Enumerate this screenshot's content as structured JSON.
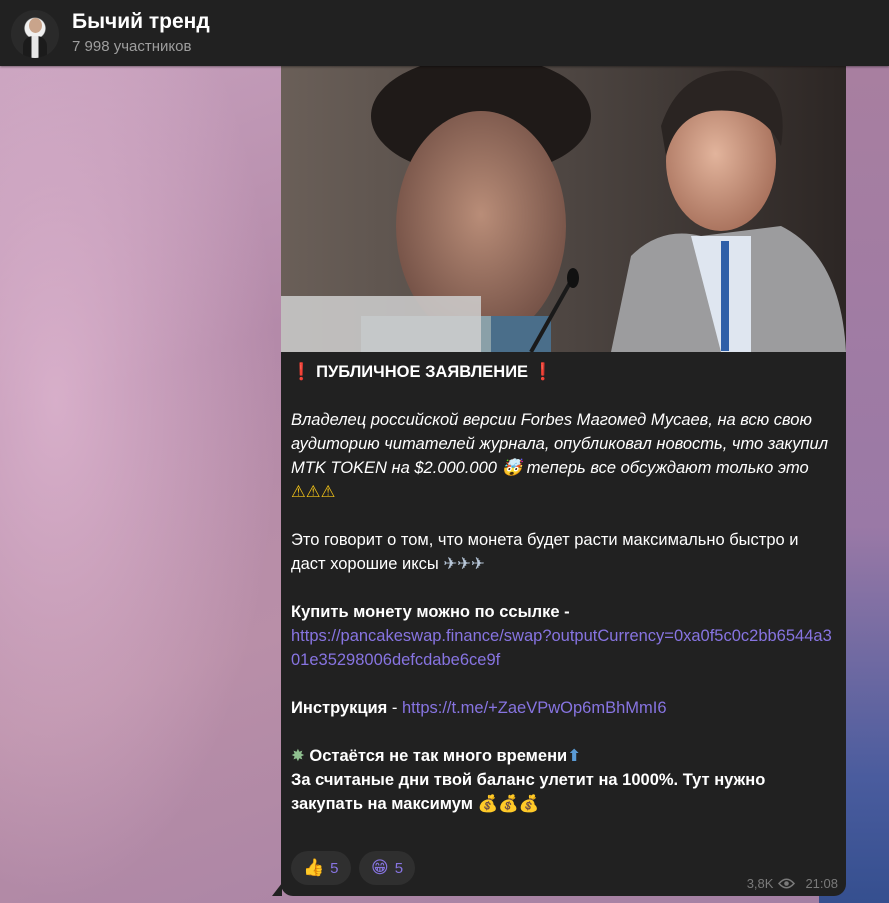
{
  "header": {
    "title": "Бычий тренд",
    "subtitle": "7 998 участников"
  },
  "post": {
    "heading_mark_left": "❗",
    "heading": "ПУБЛИЧНОЕ ЗАЯВЛЕНИЕ",
    "heading_mark_right": "❗",
    "para1": "Владелец российской версии Forbes Магомед Мусаев, на всю свою аудиторию читателей журнала, опубликовал новость, что закупил MTK TOKEN на $2.000.000",
    "para1_emoji": "🤯",
    "para1_tail": " теперь все обсуждают только это",
    "para1_warnings": "⚠⚠⚠",
    "para2": "Это говорит о том, что монета будет расти максимально быстро и даст хорошие иксы",
    "para2_planes": "✈✈✈",
    "buy_label": "Купить монету можно по ссылке -",
    "buy_link": "https://pancakeswap.finance/swap?outputCurrency=0xa0f5c0c2bb6544a301e35298006defcdabe6ce9f",
    "instr_label": "Инструкция",
    "instr_sep": " - ",
    "instr_link": "https://t.me/+ZaeVPwOp6mBhMmI6",
    "time_icon": "✸",
    "time_text": " Остаётся не так много времени",
    "time_arrow": "⬆",
    "final_text": "За считаные дни твой баланс улетит на 1000%. Тут нужно закупать на максимум",
    "final_bags": "💰💰💰"
  },
  "reactions": [
    {
      "emoji": "👍",
      "count": "5"
    },
    {
      "emoji": "😁",
      "count": "5"
    }
  ],
  "meta": {
    "views": "3,8K",
    "time": "21:08"
  }
}
